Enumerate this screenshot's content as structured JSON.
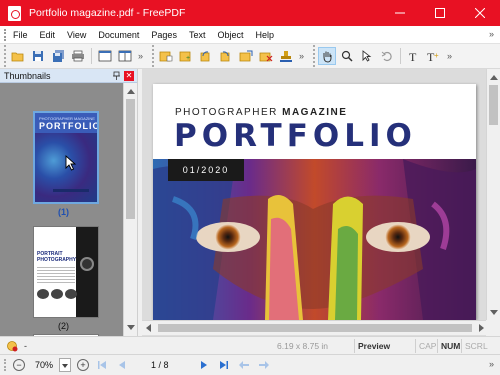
{
  "window": {
    "title": "Portfolio magazine.pdf - FreePDF",
    "icon": "freepdf-app-icon",
    "title_bar_color": "#e81123"
  },
  "menu": {
    "items": [
      "File",
      "Edit",
      "View",
      "Document",
      "Pages",
      "Text",
      "Object",
      "Help"
    ],
    "overflow": "»"
  },
  "toolbar": {
    "overflow_1": "»",
    "overflow_2": "»",
    "overflow_3": "»"
  },
  "thumbnails": {
    "header": "Thumbnails",
    "close_glyph": "✕",
    "pages": [
      {
        "label": "(1)",
        "cover_small": "PHOTOGRAPHER MAGAZINE",
        "cover_big": "PORTFOLIO",
        "selected": true
      },
      {
        "label": "(2)",
        "title": "PORTRAIT PHOTOGRAPHY",
        "selected": false
      }
    ]
  },
  "document": {
    "subtitle_plain": "PHOTOGRAPHER ",
    "subtitle_bold": "MAGAZINE",
    "headline": "PORTFOLIO",
    "date_badge": "01/2020",
    "accent_color": "#25307a"
  },
  "status": {
    "dash": "-",
    "page_size": "6.19 x 8.75 in",
    "mode": "Preview",
    "cap": "CAP",
    "num": "NUM",
    "scrl": "SCRL"
  },
  "navigation": {
    "zoom_out": "−",
    "zoom": "70%",
    "zoom_in": "+",
    "page_indicator": "1 / 8",
    "overflow": "»"
  }
}
